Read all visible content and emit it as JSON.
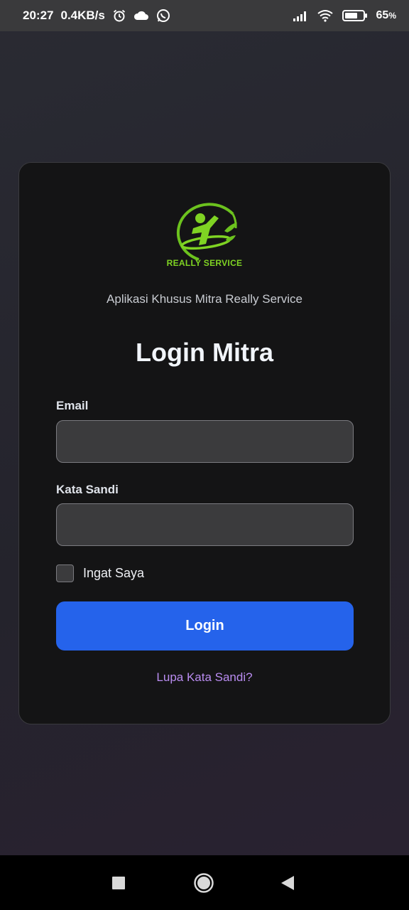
{
  "status_bar": {
    "time": "20:27",
    "network_speed": "0.4KB/s",
    "battery_percent": "65",
    "battery_suffix": "%",
    "icons": [
      "alarm-icon",
      "cloud-icon",
      "whatsapp-icon",
      "signal-icon",
      "wifi-icon",
      "battery-icon"
    ]
  },
  "card": {
    "logo_text": "REALLY SERVICE",
    "subtitle": "Aplikasi Khusus Mitra Really Service",
    "title": "Login Mitra",
    "email": {
      "label": "Email",
      "value": "",
      "placeholder": ""
    },
    "password": {
      "label": "Kata Sandi",
      "value": "",
      "placeholder": ""
    },
    "remember": {
      "label": "Ingat Saya",
      "checked": false
    },
    "login_button": "Login",
    "forgot_link": "Lupa Kata Sandi?"
  },
  "nav_bar": {
    "buttons": [
      "recent-apps-icon",
      "home-icon",
      "back-icon"
    ]
  },
  "colors": {
    "accent_button": "#2563eb",
    "logo_green": "#7fd323",
    "link_purple": "#b98cf0",
    "card_background": "#141415"
  }
}
